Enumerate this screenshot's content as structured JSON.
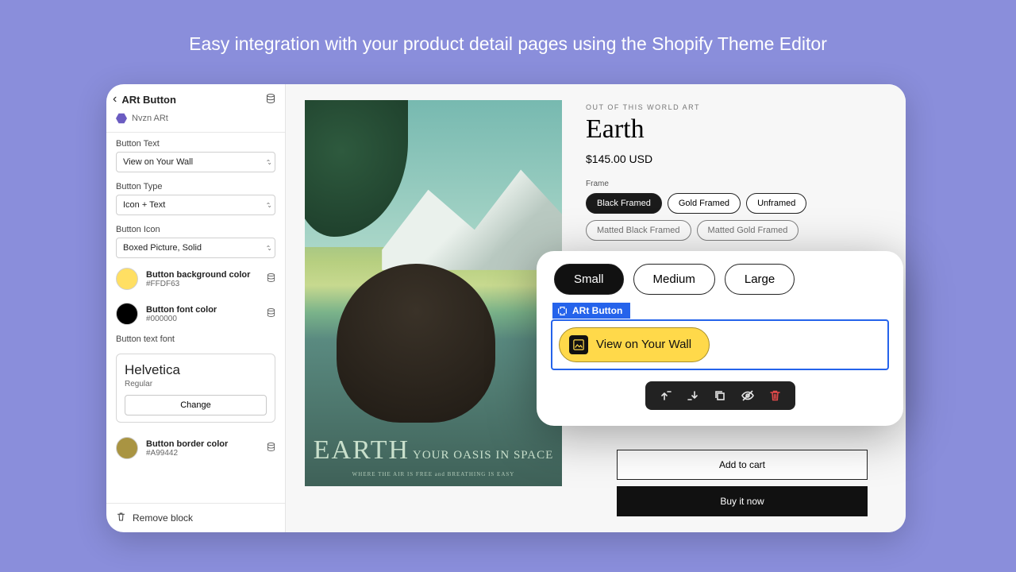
{
  "headline": "Easy integration with your product detail pages using the Shopify Theme Editor",
  "sidebar": {
    "title": "ARt Button",
    "app_name": "Nvzn ARt",
    "fields": {
      "button_text": {
        "label": "Button Text",
        "value": "View on Your Wall"
      },
      "button_type": {
        "label": "Button Type",
        "value": "Icon + Text"
      },
      "button_icon": {
        "label": "Button Icon",
        "value": "Boxed Picture, Solid"
      }
    },
    "colors": {
      "bg": {
        "label": "Button background color",
        "hex": "#FFDF63"
      },
      "font": {
        "label": "Button font color",
        "hex": "#000000"
      },
      "border": {
        "label": "Button border color",
        "hex": "#A99442"
      }
    },
    "font": {
      "label": "Button text font",
      "name": "Helvetica",
      "weight": "Regular",
      "change": "Change"
    },
    "remove": "Remove block"
  },
  "product": {
    "eyebrow": "OUT OF THIS WORLD ART",
    "title": "Earth",
    "price": "$145.00 USD",
    "frame_label": "Frame",
    "frames_row1": [
      "Black Framed",
      "Gold Framed",
      "Unframed"
    ],
    "frames_row2": [
      "Matted Black Framed",
      "Matted Gold Framed"
    ],
    "add_to_cart": "Add to cart",
    "buy_now": "Buy it now",
    "poster": {
      "big": "EARTH",
      "mid": "YOUR OASIS IN SPACE",
      "sm": "WHERE THE AIR IS FREE and BREATHING IS EASY"
    }
  },
  "overlay": {
    "sizes": [
      "Small",
      "Medium",
      "Large"
    ],
    "tag": "ARt Button",
    "button_label": "View on Your Wall"
  }
}
